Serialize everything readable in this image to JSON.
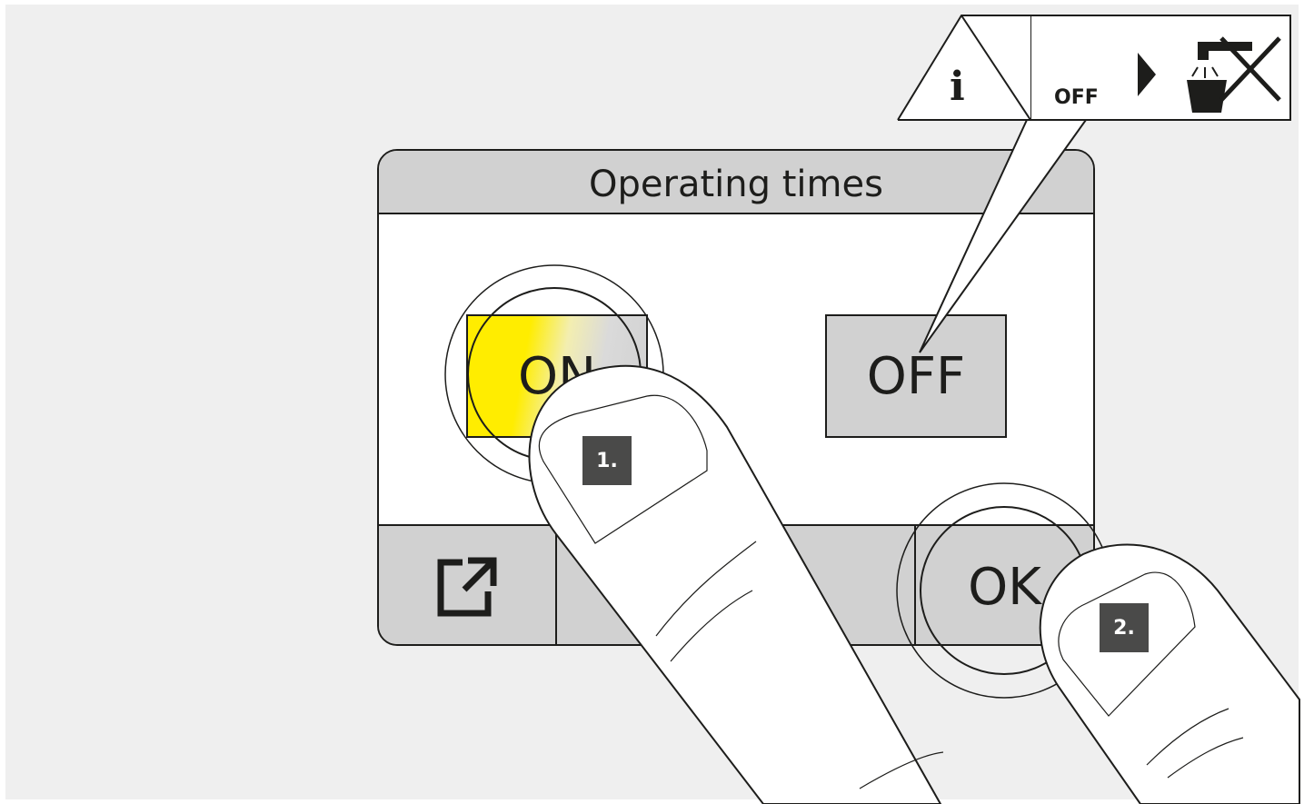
{
  "panel": {
    "title": "Operating times",
    "on_label": "ON",
    "off_label": "OFF",
    "ok_label": "OK",
    "export_icon": "export-icon"
  },
  "callout": {
    "off_label": "OFF",
    "info_icon": "info-icon",
    "arrow_icon": "arrow-right-icon",
    "tap_off_icon": "water-tap-crossed-icon"
  },
  "steps": {
    "step1": "1.",
    "step2": "2."
  },
  "colors": {
    "on_highlight": "#ffed00",
    "button_gray": "#d1d1d1",
    "outline": "#1d1d1b",
    "badge": "#4a4a49"
  }
}
